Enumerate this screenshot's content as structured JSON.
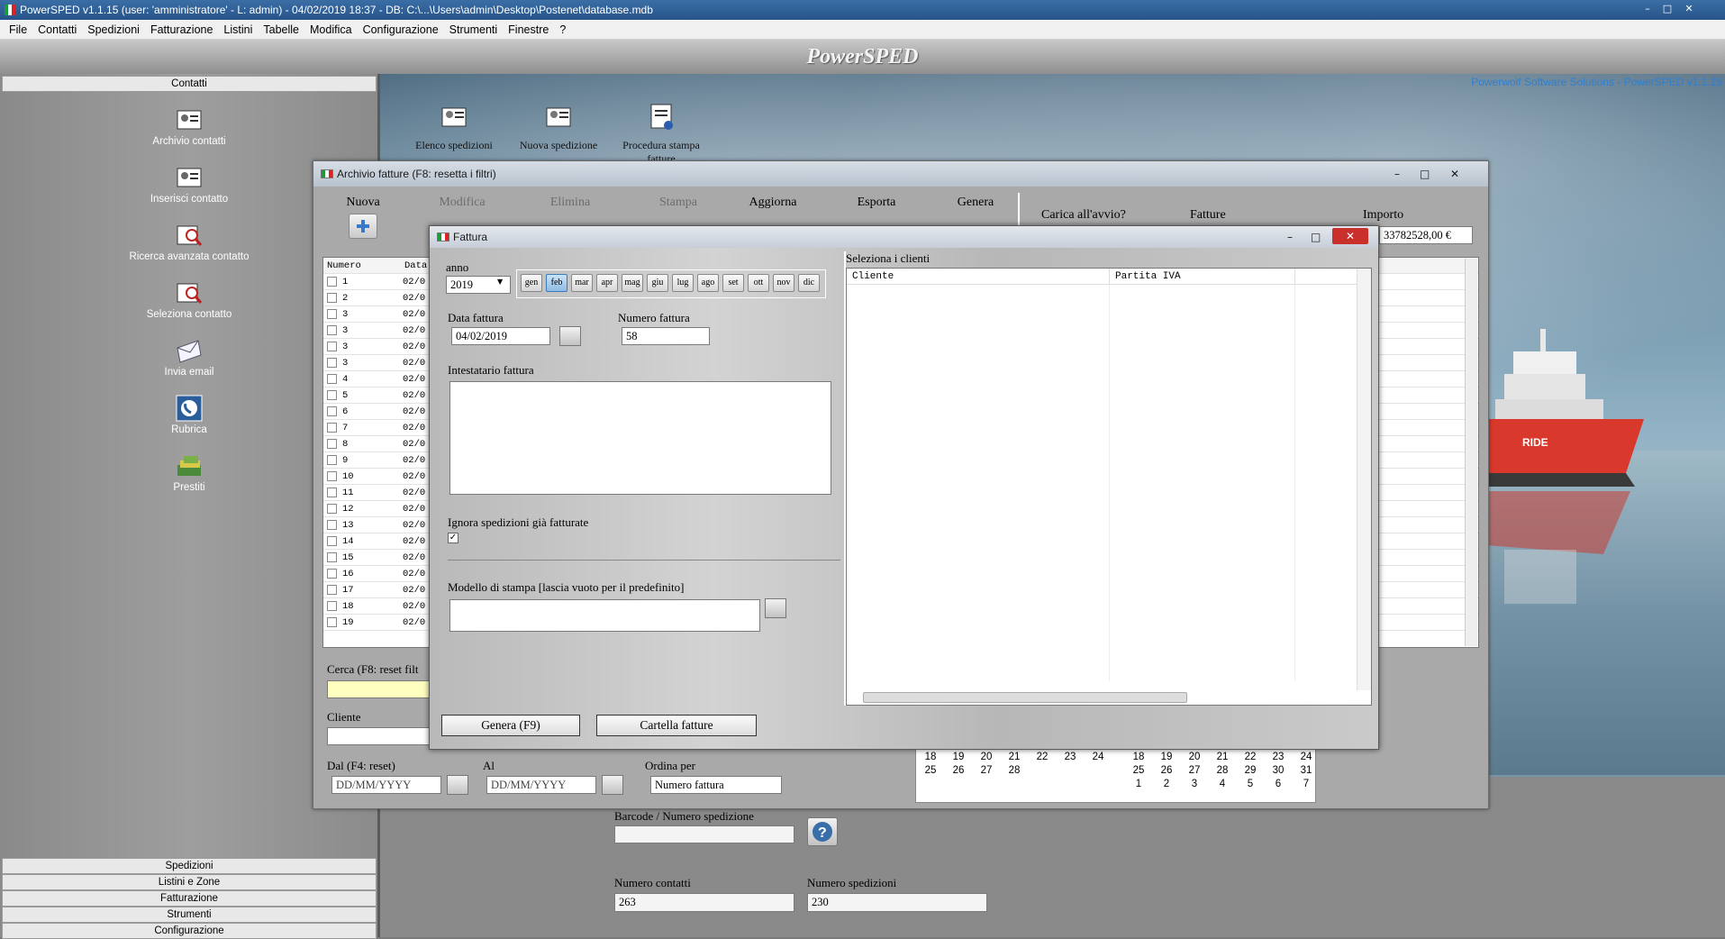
{
  "window": {
    "title": "PowerSPED v1.1.15  (user: 'amministratore'  - L: admin) - 04/02/2019 18:37 - DB: C:\\...\\Users\\admin\\Desktop\\Postenet\\database.mdb"
  },
  "menu": [
    "File",
    "Contatti",
    "Spedizioni",
    "Fatturazione",
    "Listini",
    "Tabelle",
    "Modifica",
    "Configurazione",
    "Strumenti",
    "Finestre",
    "?"
  ],
  "app_title": "PowerSPED",
  "credits": "Powerwolf Software Solutions - PowerSPED v1.1.15",
  "sidebar": {
    "header": "Contatti",
    "items": [
      "Archivio contatti",
      "Inserisci contatto",
      "Ricerca avanzata contatto",
      "Seleziona contatto",
      "Invia email",
      "Rubrica",
      "Prestiti"
    ],
    "bottom_sections": [
      "Spedizioni",
      "Listini e Zone",
      "Fatturazione",
      "Strumenti",
      "Configurazione"
    ]
  },
  "desktop_icons": [
    "Elenco spedizioni",
    "Nuova spedizione",
    "Procedura stampa fatture"
  ],
  "archive": {
    "title": "Archivio fatture (F8: resetta i filtri)",
    "toolbar": [
      "Nuova",
      "Modifica",
      "Elimina",
      "Stampa",
      "Aggiorna",
      "Esporta",
      "Genera"
    ],
    "carica_label": "Carica all'avvio?",
    "fatture_label": "Fatture",
    "importo_label": "Importo",
    "importo_value": "33782528,00 €",
    "col_numero": "Numero",
    "col_data": "Data",
    "rows": [
      {
        "n": "1",
        "d": "02/0"
      },
      {
        "n": "2",
        "d": "02/0"
      },
      {
        "n": "3",
        "d": "02/0"
      },
      {
        "n": "3",
        "d": "02/0"
      },
      {
        "n": "3",
        "d": "02/0"
      },
      {
        "n": "3",
        "d": "02/0"
      },
      {
        "n": "4",
        "d": "02/0"
      },
      {
        "n": "5",
        "d": "02/0"
      },
      {
        "n": "6",
        "d": "02/0"
      },
      {
        "n": "7",
        "d": "02/0"
      },
      {
        "n": "8",
        "d": "02/0"
      },
      {
        "n": "9",
        "d": "02/0"
      },
      {
        "n": "10",
        "d": "02/0"
      },
      {
        "n": "11",
        "d": "02/0"
      },
      {
        "n": "12",
        "d": "02/0"
      },
      {
        "n": "13",
        "d": "02/0"
      },
      {
        "n": "14",
        "d": "02/0"
      },
      {
        "n": "15",
        "d": "02/0"
      },
      {
        "n": "16",
        "d": "02/0"
      },
      {
        "n": "17",
        "d": "02/0"
      },
      {
        "n": "18",
        "d": "02/0"
      },
      {
        "n": "19",
        "d": "02/0"
      }
    ],
    "cerca_label": "Cerca (F8: reset filt",
    "cliente_label": "Cliente",
    "dal_label": "Dal (F4: reset)",
    "al_label": "Al",
    "date_placeholder": "DD/MM/YYYY",
    "ordina_label": "Ordina per",
    "ordina_value": "Numero fattura",
    "calendar_left": [
      [
        "18",
        "19",
        "20",
        "21",
        "22",
        "23",
        "24"
      ],
      [
        "25",
        "26",
        "27",
        "28",
        "",
        "",
        ""
      ]
    ],
    "calendar_right": [
      [
        "18",
        "19",
        "20",
        "21",
        "22",
        "23",
        "24"
      ],
      [
        "25",
        "26",
        "27",
        "28",
        "29",
        "30",
        "31"
      ],
      [
        "1",
        "2",
        "3",
        "4",
        "5",
        "6",
        "7"
      ]
    ]
  },
  "bottom": {
    "barcode_label": "Barcode / Numero spedizione",
    "numero_contatti_label": "Numero contatti",
    "numero_contatti_value": "263",
    "numero_spedizioni_label": "Numero spedizioni",
    "numero_spedizioni_value": "230"
  },
  "fattura": {
    "title": "Fattura",
    "anno_label": "anno",
    "anno_value": "2019",
    "months": [
      "gen",
      "feb",
      "mar",
      "apr",
      "mag",
      "giu",
      "lug",
      "ago",
      "set",
      "ott",
      "nov",
      "dic"
    ],
    "selected_month": "feb",
    "data_label": "Data fattura",
    "data_value": "04/02/2019",
    "numero_label": "Numero fattura",
    "numero_value": "58",
    "intestatario_label": "Intestatario fattura",
    "ignora_label": "Ignora spedizioni già fatturate",
    "modello_label": "Modello di stampa [lascia vuoto per il predefinito]",
    "clienti_label": "Seleziona i clienti",
    "col_cliente": "Cliente",
    "col_piva": "Partita IVA",
    "genera_btn": "Genera (F9)",
    "cartella_btn": "Cartella fatture"
  }
}
